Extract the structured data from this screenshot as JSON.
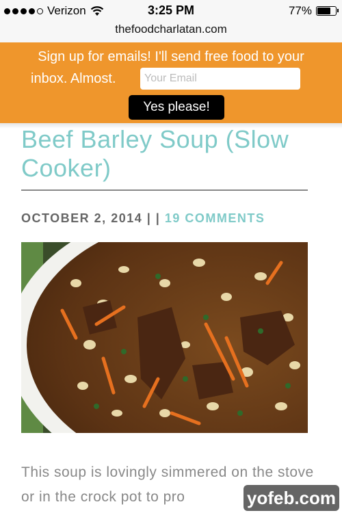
{
  "status_bar": {
    "carrier": "Verizon",
    "time": "3:25 PM",
    "battery": "77%",
    "battery_level": 0.77,
    "signal_bars_filled": 4,
    "signal_bars_total": 5
  },
  "browser": {
    "url": "thefoodcharlatan.com"
  },
  "banner": {
    "line1": "Sign up for emails! I'll send free food to your",
    "line2": "inbox. Almost.",
    "email_placeholder": "Your Email",
    "button_label": "Yes please!",
    "color": "#ef962c"
  },
  "post": {
    "title": "Beef Barley Soup (Slow Cooker)",
    "date": "OCTOBER 2, 2014",
    "separator": "| |",
    "comments": "19 COMMENTS",
    "accent_color": "#7fcac8",
    "intro": "This soup is lovingly simmered on the stove or in the crock pot to pro"
  },
  "watermark": {
    "text": "yofeb.com"
  }
}
